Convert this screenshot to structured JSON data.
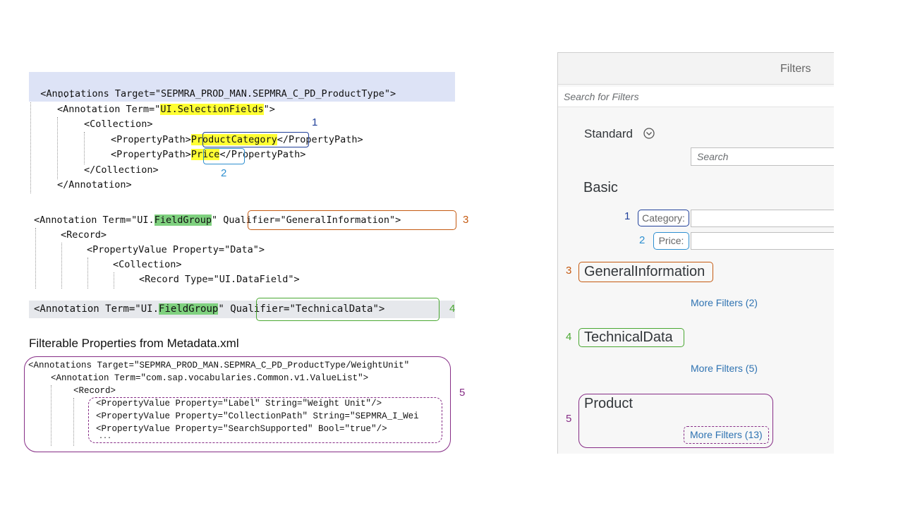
{
  "code": {
    "block1": {
      "line1": "<Annotations Target=\"SEPMRA_PROD_MAN.SEPMRA_C_PD_ProductType\">",
      "line2": "...",
      "line3_pre": "<Annotation Term=\"",
      "line3_hl": "UI.SelectionFields",
      "line3_post": "\">",
      "line4": "<Collection>",
      "line5_pre": "<PropertyPath>",
      "line5_hl": "ProductCategory",
      "line5_post": "</PropertyPath>",
      "line6_pre": "<PropertyPath>",
      "line6_hl": "Price",
      "line6_post": "</PropertyPath>",
      "line7": "</Collection>",
      "line8": "</Annotation>"
    },
    "block2": {
      "line1_pre": "<Annotation Term=\"UI.",
      "line1_hl": "FieldGroup",
      "line1_mid": "\"",
      "line1_qual": "Qualifier=\"GeneralInformation\">",
      "line2": "<Record>",
      "line3": "<PropertyValue Property=\"Data\">",
      "line4": "<Collection>",
      "line5": "<Record Type=\"UI.DataField\">"
    },
    "block3": {
      "line1_pre": "<Annotation Term=\"UI.",
      "line1_hl": "FieldGroup",
      "line1_mid": "\"",
      "line1_qual": "Qualifier=\"TechnicalData\">"
    },
    "metadata_caption": "Filterable Properties from Metadata.xml",
    "block4": {
      "line1": "<Annotations Target=\"SEPMRA_PROD_MAN.SEPMRA_C_PD_ProductType/WeightUnit\"",
      "line2": "<Annotation Term=\"com.sap.vocabularies.Common.v1.ValueList\">",
      "line3": "<Record>",
      "line4": "<PropertyValue Property=\"Label\" String=\"Weight Unit\"/>",
      "line5": "<PropertyValue Property=\"CollectionPath\" String=\"SEPMRA_I_Wei",
      "line6": "<PropertyValue Property=\"SearchSupported\" Bool=\"true\"/>",
      "line7": "..."
    }
  },
  "markers": {
    "m1": "1",
    "m2": "2",
    "m3": "3",
    "m4": "4",
    "m5": "5"
  },
  "filter_panel": {
    "title": "Filters",
    "search_placeholder": "Search for Filters",
    "standard_title": "Standard",
    "standard_search_placeholder": "Search",
    "basic_title": "Basic",
    "category_label": "Category:",
    "price_label": "Price:",
    "general_title": "GeneralInformation",
    "general_more": "More Filters (2)",
    "technical_title": "TechnicalData",
    "technical_more": "More Filters (5)",
    "product_title": "Product",
    "product_more": "More Filters (13)"
  },
  "colors": {
    "marker1": "#1f3f99",
    "marker2": "#2e8fd0",
    "marker3": "#c55a11",
    "marker4": "#4aa832",
    "marker5": "#862d86",
    "highlight_yellow": "#ffff33",
    "highlight_green": "#7fd17f",
    "highlight_blue": "#dde3f6",
    "link": "#2f73b2"
  }
}
